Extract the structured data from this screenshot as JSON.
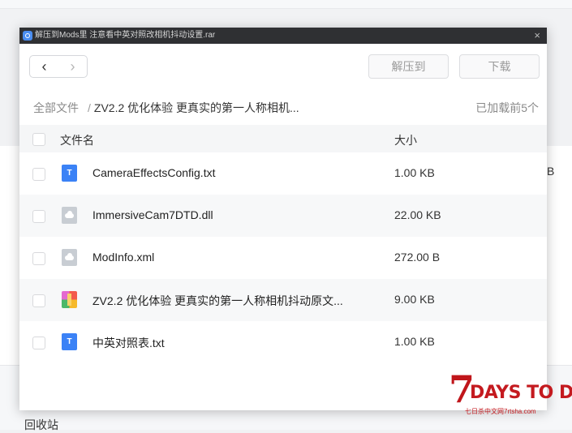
{
  "background": {
    "partial_size": "B",
    "recycle_bin": "回收站"
  },
  "dialog": {
    "title": "解压到Mods里 注意看中英对照改相机抖动设置.rar",
    "close": "×",
    "nav": {
      "back": "‹",
      "forward": "›"
    },
    "extract_button": "解压到",
    "download_button": "下载",
    "breadcrumb": {
      "root": "全部文件",
      "separator": "/",
      "current": "ZV2.2 优化体验 更真实的第一人称相机..."
    },
    "loaded_count": "已加载前5个",
    "columns": {
      "name": "文件名",
      "size": "大小"
    },
    "files": [
      {
        "name": "CameraEffectsConfig.txt",
        "size": "1.00 KB",
        "icon": "txt-file-icon",
        "icon_label": "T"
      },
      {
        "name": "ImmersiveCam7DTD.dll",
        "size": "22.00 KB",
        "icon": "generic-file-icon"
      },
      {
        "name": "ModInfo.xml",
        "size": "272.00 B",
        "icon": "generic-file-icon"
      },
      {
        "name": "ZV2.2 优化体验 更真实的第一人称相机抖动原文...",
        "size": "9.00 KB",
        "icon": "archive-file-icon"
      },
      {
        "name": "中英对照表.txt",
        "size": "1.00 KB",
        "icon": "txt-file-icon",
        "icon_label": "T"
      }
    ]
  },
  "watermark": {
    "number": "7",
    "text": "DAYS TO DIE",
    "subtext": "七日杀中文网7rtsha.com"
  },
  "colors": {
    "accent": "#3b82f6",
    "titlebar": "#2f3033",
    "logo_red": "#c0161b"
  }
}
